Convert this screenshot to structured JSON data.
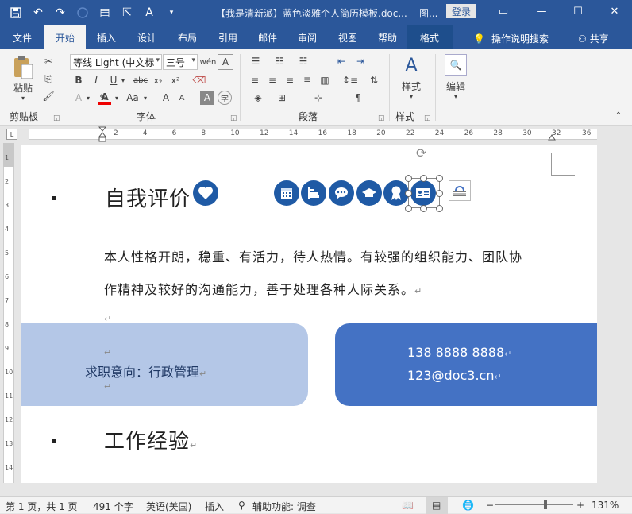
{
  "window": {
    "title": "【我是清新派】蓝色淡雅个人简历模板.doc...",
    "contextual_tool": "图...",
    "login_label": "登录"
  },
  "tabs": [
    {
      "label": "文件"
    },
    {
      "label": "开始",
      "active": true
    },
    {
      "label": "插入"
    },
    {
      "label": "设计"
    },
    {
      "label": "布局"
    },
    {
      "label": "引用"
    },
    {
      "label": "邮件"
    },
    {
      "label": "审阅"
    },
    {
      "label": "视图"
    },
    {
      "label": "帮助"
    },
    {
      "label": "格式"
    }
  ],
  "tell_me": "操作说明搜索",
  "share": "共享",
  "ribbon": {
    "clipboard": {
      "paste_label": "粘贴",
      "group_label": "剪贴板"
    },
    "font": {
      "font_name": "等线 Light (中文标",
      "font_size": "三号",
      "group_label": "字体"
    },
    "paragraph": {
      "group_label": "段落"
    },
    "styles": {
      "button_label": "样式",
      "group_label": "样式"
    },
    "editing": {
      "button_label": "编辑"
    }
  },
  "ruler": {
    "h_numbers": [
      "2",
      "4",
      "6",
      "8",
      "10",
      "12",
      "14",
      "16",
      "18",
      "20",
      "22",
      "24",
      "26",
      "28",
      "30",
      "32",
      "36"
    ],
    "v_numbers": [
      "1",
      "2",
      "3",
      "4",
      "5",
      "6",
      "7",
      "8",
      "9",
      "10",
      "11",
      "12",
      "13",
      "14"
    ]
  },
  "document": {
    "heading1": "自我评价",
    "para_line1": "本人性格开朗，稳重、有活力，待人热情。有较强的组织能力、团队协",
    "para_line2": "作精神及较好的沟通能力，善于处理各种人际关系。",
    "job_intent": "求职意向：行政管理",
    "phone": "138 8888 8888",
    "email": "123@doc3.cn",
    "heading2": "工作经验",
    "para_mark": "↵"
  },
  "status": {
    "page": "第 1 页，共 1 页",
    "words": "491 个字",
    "language": "英语(美国)",
    "insert": "插入",
    "accessibility": "辅助功能: 调查",
    "zoom": "131%",
    "zoom_level": 0.62
  },
  "colors": {
    "brand": "#2b579a",
    "card_light": "#b4c7e7",
    "card_dark": "#4472c4",
    "icon_blue": "#1f5aa5"
  }
}
